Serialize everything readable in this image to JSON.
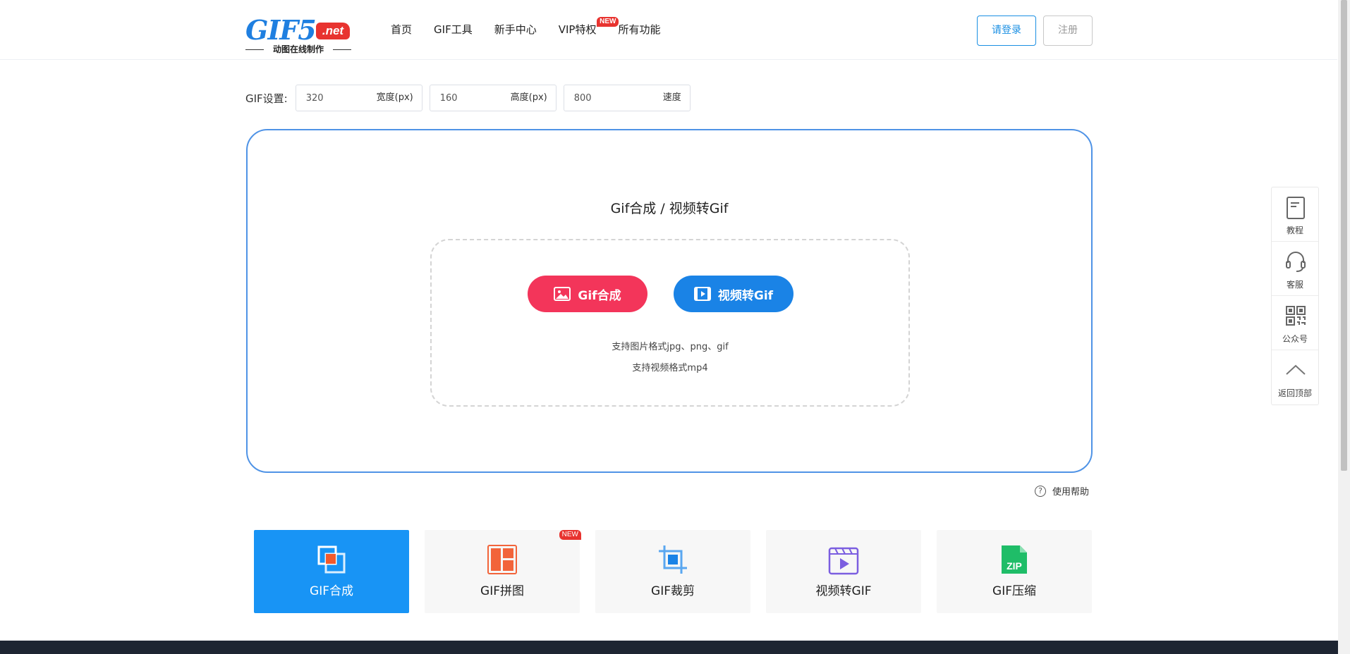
{
  "header": {
    "logo_main": "GIF5",
    "logo_badge": ".net",
    "logo_sub": "动图在线制作",
    "nav": [
      "首页",
      "GIF工具",
      "新手中心",
      "VIP特权",
      "所有功能"
    ],
    "new_tag": "NEW",
    "login_label": "请登录",
    "register_label": "注册"
  },
  "settings": {
    "label": "GIF设置:",
    "width_value": "320",
    "width_unit": "宽度(px)",
    "height_value": "160",
    "height_unit": "高度(px)",
    "speed_value": "800",
    "speed_unit": "速度"
  },
  "upload": {
    "title": "Gif合成 / 视频转Gif",
    "btn_gif": "Gif合成",
    "btn_video": "视频转Gif",
    "support_images": "支持图片格式jpg、png、gif",
    "support_video": "支持视频格式mp4"
  },
  "help_label": "使用帮助",
  "tools": [
    {
      "label": "GIF合成",
      "icon": "merge-icon",
      "active": true
    },
    {
      "label": "GIF拼图",
      "icon": "collage-icon",
      "badge": "NEW"
    },
    {
      "label": "GIF裁剪",
      "icon": "crop-icon"
    },
    {
      "label": "视频转GIF",
      "icon": "video-icon"
    },
    {
      "label": "GIF压缩",
      "icon": "zip-icon"
    }
  ],
  "side": [
    "教程",
    "客服",
    "公众号",
    "返回顶部"
  ],
  "colors": {
    "brand_blue": "#1a83e6",
    "brand_red": "#f3355a",
    "active_card": "#1894f5",
    "footer": "#1e2532"
  }
}
